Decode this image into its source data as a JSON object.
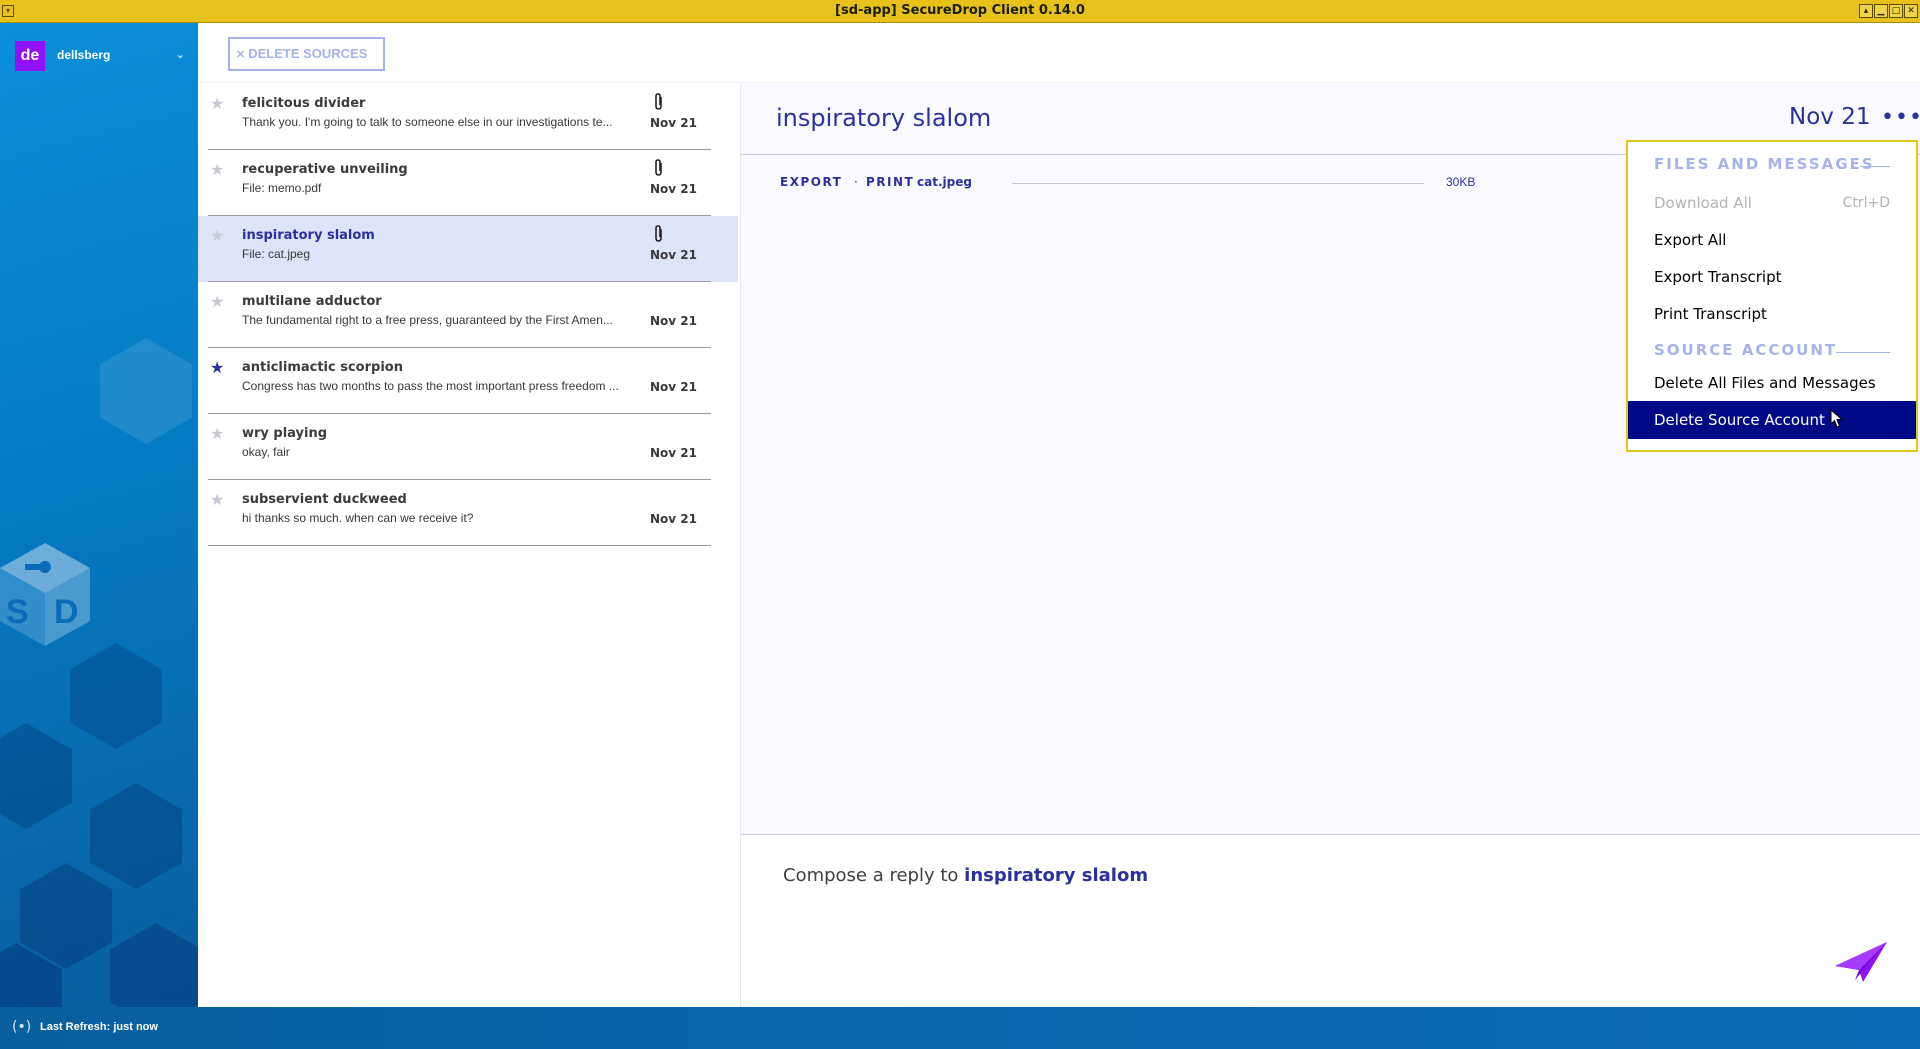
{
  "window": {
    "title": "[sd-app] SecureDrop Client 0.14.0"
  },
  "user": {
    "initials": "de",
    "name": "dellsberg"
  },
  "toolbar": {
    "delete_sources_label": "DELETE SOURCES"
  },
  "sources": [
    {
      "name": "felicitous divider",
      "preview": "Thank you. I'm going to talk to someone else in our investigations te...",
      "date": "Nov 21",
      "starred": false,
      "attachment": true,
      "selected": false
    },
    {
      "name": "recuperative unveiling",
      "preview": "File: memo.pdf",
      "date": "Nov 21",
      "starred": false,
      "attachment": true,
      "selected": false
    },
    {
      "name": "inspiratory slalom",
      "preview": "File: cat.jpeg",
      "date": "Nov 21",
      "starred": false,
      "attachment": true,
      "selected": true
    },
    {
      "name": "multilane adductor",
      "preview": "The fundamental right to a free press, guaranteed by the First Amen...",
      "date": "Nov 21",
      "starred": false,
      "attachment": false,
      "selected": false
    },
    {
      "name": "anticlimactic scorpion",
      "preview": "Congress has two months to pass the most important press freedom ...",
      "date": "Nov 21",
      "starred": true,
      "attachment": false,
      "selected": false
    },
    {
      "name": "wry playing",
      "preview": "okay, fair",
      "date": "Nov 21",
      "starred": false,
      "attachment": false,
      "selected": false
    },
    {
      "name": "subservient duckweed",
      "preview": "hi thanks so much. when can we receive it?",
      "date": "Nov 21",
      "starred": false,
      "attachment": false,
      "selected": false
    }
  ],
  "conversation": {
    "title": "inspiratory slalom",
    "date": "Nov 21",
    "file": {
      "export_label": "EXPORT",
      "separator": "·",
      "print_label": "PRINT",
      "name": "cat.jpeg",
      "size": "30KB"
    },
    "compose_prefix": "Compose a reply to ",
    "compose_name": "inspiratory slalom"
  },
  "menu": {
    "section_files": "FILES AND MESSAGES",
    "download_all": "Download All",
    "download_shortcut": "Ctrl+D",
    "export_all": "Export All",
    "export_transcript": "Export Transcript",
    "print_transcript": "Print Transcript",
    "section_account": "SOURCE ACCOUNT",
    "delete_all_files": "Delete All Files and Messages",
    "delete_source_account": "Delete Source Account"
  },
  "status": {
    "last_refresh": "Last Refresh: just now"
  },
  "colors": {
    "accent": "#2a319d",
    "title_bar": "#e7c21a",
    "menu_highlight": "#000a87",
    "avatar": "#9211ff",
    "send": "#9211ff"
  }
}
